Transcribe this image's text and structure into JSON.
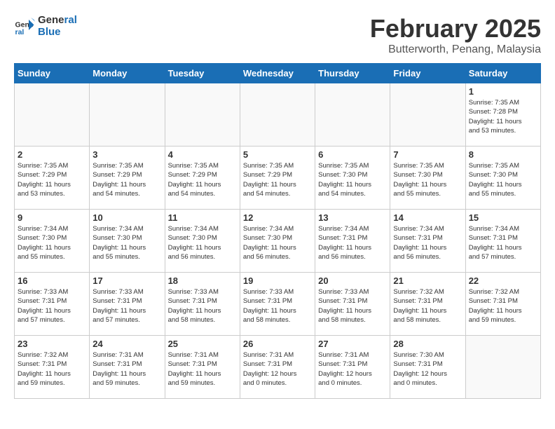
{
  "logo": {
    "line1": "General",
    "line2": "Blue"
  },
  "title": "February 2025",
  "subtitle": "Butterworth, Penang, Malaysia",
  "days_of_week": [
    "Sunday",
    "Monday",
    "Tuesday",
    "Wednesday",
    "Thursday",
    "Friday",
    "Saturday"
  ],
  "weeks": [
    [
      {
        "day": "",
        "info": ""
      },
      {
        "day": "",
        "info": ""
      },
      {
        "day": "",
        "info": ""
      },
      {
        "day": "",
        "info": ""
      },
      {
        "day": "",
        "info": ""
      },
      {
        "day": "",
        "info": ""
      },
      {
        "day": "1",
        "info": "Sunrise: 7:35 AM\nSunset: 7:28 PM\nDaylight: 11 hours\nand 53 minutes."
      }
    ],
    [
      {
        "day": "2",
        "info": "Sunrise: 7:35 AM\nSunset: 7:29 PM\nDaylight: 11 hours\nand 53 minutes."
      },
      {
        "day": "3",
        "info": "Sunrise: 7:35 AM\nSunset: 7:29 PM\nDaylight: 11 hours\nand 54 minutes."
      },
      {
        "day": "4",
        "info": "Sunrise: 7:35 AM\nSunset: 7:29 PM\nDaylight: 11 hours\nand 54 minutes."
      },
      {
        "day": "5",
        "info": "Sunrise: 7:35 AM\nSunset: 7:29 PM\nDaylight: 11 hours\nand 54 minutes."
      },
      {
        "day": "6",
        "info": "Sunrise: 7:35 AM\nSunset: 7:30 PM\nDaylight: 11 hours\nand 54 minutes."
      },
      {
        "day": "7",
        "info": "Sunrise: 7:35 AM\nSunset: 7:30 PM\nDaylight: 11 hours\nand 55 minutes."
      },
      {
        "day": "8",
        "info": "Sunrise: 7:35 AM\nSunset: 7:30 PM\nDaylight: 11 hours\nand 55 minutes."
      }
    ],
    [
      {
        "day": "9",
        "info": "Sunrise: 7:34 AM\nSunset: 7:30 PM\nDaylight: 11 hours\nand 55 minutes."
      },
      {
        "day": "10",
        "info": "Sunrise: 7:34 AM\nSunset: 7:30 PM\nDaylight: 11 hours\nand 55 minutes."
      },
      {
        "day": "11",
        "info": "Sunrise: 7:34 AM\nSunset: 7:30 PM\nDaylight: 11 hours\nand 56 minutes."
      },
      {
        "day": "12",
        "info": "Sunrise: 7:34 AM\nSunset: 7:30 PM\nDaylight: 11 hours\nand 56 minutes."
      },
      {
        "day": "13",
        "info": "Sunrise: 7:34 AM\nSunset: 7:31 PM\nDaylight: 11 hours\nand 56 minutes."
      },
      {
        "day": "14",
        "info": "Sunrise: 7:34 AM\nSunset: 7:31 PM\nDaylight: 11 hours\nand 56 minutes."
      },
      {
        "day": "15",
        "info": "Sunrise: 7:34 AM\nSunset: 7:31 PM\nDaylight: 11 hours\nand 57 minutes."
      }
    ],
    [
      {
        "day": "16",
        "info": "Sunrise: 7:33 AM\nSunset: 7:31 PM\nDaylight: 11 hours\nand 57 minutes."
      },
      {
        "day": "17",
        "info": "Sunrise: 7:33 AM\nSunset: 7:31 PM\nDaylight: 11 hours\nand 57 minutes."
      },
      {
        "day": "18",
        "info": "Sunrise: 7:33 AM\nSunset: 7:31 PM\nDaylight: 11 hours\nand 58 minutes."
      },
      {
        "day": "19",
        "info": "Sunrise: 7:33 AM\nSunset: 7:31 PM\nDaylight: 11 hours\nand 58 minutes."
      },
      {
        "day": "20",
        "info": "Sunrise: 7:33 AM\nSunset: 7:31 PM\nDaylight: 11 hours\nand 58 minutes."
      },
      {
        "day": "21",
        "info": "Sunrise: 7:32 AM\nSunset: 7:31 PM\nDaylight: 11 hours\nand 58 minutes."
      },
      {
        "day": "22",
        "info": "Sunrise: 7:32 AM\nSunset: 7:31 PM\nDaylight: 11 hours\nand 59 minutes."
      }
    ],
    [
      {
        "day": "23",
        "info": "Sunrise: 7:32 AM\nSunset: 7:31 PM\nDaylight: 11 hours\nand 59 minutes."
      },
      {
        "day": "24",
        "info": "Sunrise: 7:31 AM\nSunset: 7:31 PM\nDaylight: 11 hours\nand 59 minutes."
      },
      {
        "day": "25",
        "info": "Sunrise: 7:31 AM\nSunset: 7:31 PM\nDaylight: 11 hours\nand 59 minutes."
      },
      {
        "day": "26",
        "info": "Sunrise: 7:31 AM\nSunset: 7:31 PM\nDaylight: 12 hours\nand 0 minutes."
      },
      {
        "day": "27",
        "info": "Sunrise: 7:31 AM\nSunset: 7:31 PM\nDaylight: 12 hours\nand 0 minutes."
      },
      {
        "day": "28",
        "info": "Sunrise: 7:30 AM\nSunset: 7:31 PM\nDaylight: 12 hours\nand 0 minutes."
      },
      {
        "day": "",
        "info": ""
      }
    ]
  ]
}
